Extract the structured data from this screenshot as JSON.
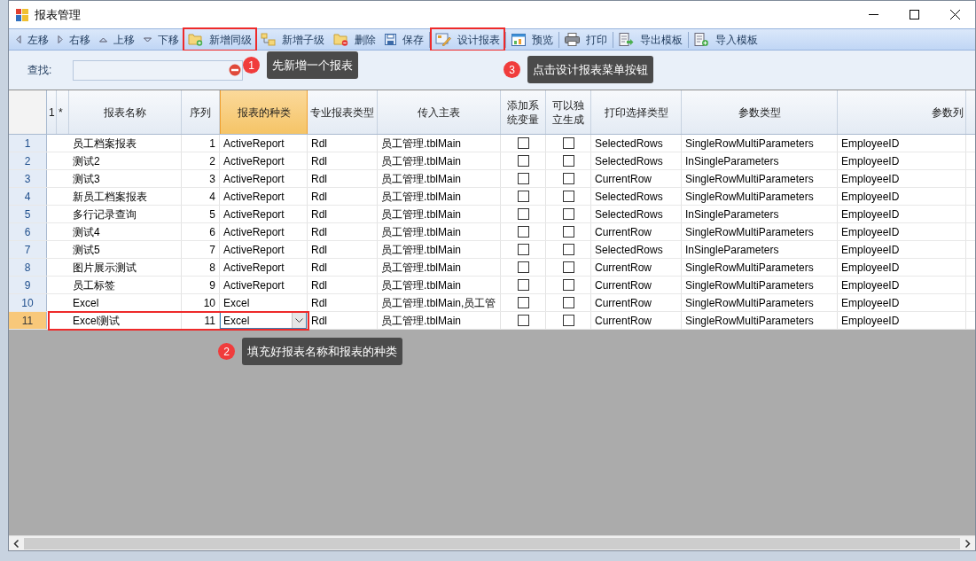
{
  "window": {
    "title": "报表管理"
  },
  "toolbar": [
    {
      "kind": "left",
      "label": "左移",
      "highlighted": false
    },
    {
      "kind": "right",
      "label": "右移",
      "highlighted": false
    },
    {
      "kind": "up",
      "label": "上移",
      "highlighted": false
    },
    {
      "kind": "down",
      "label": "下移",
      "highlighted": false
    },
    {
      "kind": "folder-add",
      "label": "新增同级",
      "highlighted": true
    },
    {
      "kind": "tree",
      "label": "新增子级",
      "highlighted": false
    },
    {
      "kind": "folder-remove",
      "label": "删除",
      "highlighted": false
    },
    {
      "kind": "save",
      "label": "保存",
      "highlighted": false
    },
    {
      "kind": "design",
      "label": "设计报表",
      "highlighted": true
    },
    {
      "kind": "preview",
      "label": "预览",
      "highlighted": false
    },
    {
      "kind": "print",
      "label": "打印",
      "highlighted": false
    },
    {
      "kind": "export",
      "label": "导出模板",
      "highlighted": false
    },
    {
      "kind": "import",
      "label": "导入模板",
      "highlighted": false
    }
  ],
  "search": {
    "label": "查找:"
  },
  "table": {
    "columns": [
      {
        "label": "1",
        "selected": false
      },
      {
        "label": "*",
        "selected": false
      },
      {
        "label": "报表名称",
        "selected": false
      },
      {
        "label": "序列",
        "selected": false
      },
      {
        "label": "报表的种类",
        "selected": true
      },
      {
        "label": "专业报表类型",
        "selected": false
      },
      {
        "label": "传入主表",
        "selected": false
      },
      {
        "label": "添加系统变量",
        "selected": false
      },
      {
        "label": "可以独立生成",
        "selected": false
      },
      {
        "label": "打印选择类型",
        "selected": false
      },
      {
        "label": "参数类型",
        "selected": false
      },
      {
        "label": "参数列",
        "selected": false
      }
    ],
    "rows": [
      {
        "number": "1",
        "selected": false,
        "highlighted": false,
        "editing": false,
        "name": "员工档案报表",
        "seq": "1",
        "report_kind": "ActiveReport",
        "pro_type": "Rdl",
        "main_table": "员工管理.tblMain",
        "add_system_variable": false,
        "independent": false,
        "print_select": "SelectedRows",
        "param_type": "SingleRowMultiParameters",
        "param_column": "EmployeeID"
      },
      {
        "number": "2",
        "selected": false,
        "highlighted": false,
        "editing": false,
        "name": "测试2",
        "seq": "2",
        "report_kind": "ActiveReport",
        "pro_type": "Rdl",
        "main_table": "员工管理.tblMain",
        "add_system_variable": false,
        "independent": false,
        "print_select": "SelectedRows",
        "param_type": "InSingleParameters",
        "param_column": "EmployeeID"
      },
      {
        "number": "3",
        "selected": false,
        "highlighted": false,
        "editing": false,
        "name": "测试3",
        "seq": "3",
        "report_kind": "ActiveReport",
        "pro_type": "Rdl",
        "main_table": "员工管理.tblMain",
        "add_system_variable": false,
        "independent": false,
        "print_select": "CurrentRow",
        "param_type": "SingleRowMultiParameters",
        "param_column": "EmployeeID"
      },
      {
        "number": "4",
        "selected": false,
        "highlighted": false,
        "editing": false,
        "name": "新员工档案报表",
        "seq": "4",
        "report_kind": "ActiveReport",
        "pro_type": "Rdl",
        "main_table": "员工管理.tblMain",
        "add_system_variable": false,
        "independent": false,
        "print_select": "SelectedRows",
        "param_type": "SingleRowMultiParameters",
        "param_column": "EmployeeID"
      },
      {
        "number": "5",
        "selected": false,
        "highlighted": false,
        "editing": false,
        "name": "多行记录查询",
        "seq": "5",
        "report_kind": "ActiveReport",
        "pro_type": "Rdl",
        "main_table": "员工管理.tblMain",
        "add_system_variable": false,
        "independent": false,
        "print_select": "SelectedRows",
        "param_type": "InSingleParameters",
        "param_column": "EmployeeID"
      },
      {
        "number": "6",
        "selected": false,
        "highlighted": false,
        "editing": false,
        "name": "测试4",
        "seq": "6",
        "report_kind": "ActiveReport",
        "pro_type": "Rdl",
        "main_table": "员工管理.tblMain",
        "add_system_variable": false,
        "independent": false,
        "print_select": "CurrentRow",
        "param_type": "SingleRowMultiParameters",
        "param_column": "EmployeeID"
      },
      {
        "number": "7",
        "selected": false,
        "highlighted": false,
        "editing": false,
        "name": "测试5",
        "seq": "7",
        "report_kind": "ActiveReport",
        "pro_type": "Rdl",
        "main_table": "员工管理.tblMain",
        "add_system_variable": false,
        "independent": false,
        "print_select": "SelectedRows",
        "param_type": "InSingleParameters",
        "param_column": "EmployeeID"
      },
      {
        "number": "8",
        "selected": false,
        "highlighted": false,
        "editing": false,
        "name": "图片展示测试",
        "seq": "8",
        "report_kind": "ActiveReport",
        "pro_type": "Rdl",
        "main_table": "员工管理.tblMain",
        "add_system_variable": false,
        "independent": false,
        "print_select": "CurrentRow",
        "param_type": "SingleRowMultiParameters",
        "param_column": "EmployeeID"
      },
      {
        "number": "9",
        "selected": false,
        "highlighted": false,
        "editing": false,
        "name": "员工标签",
        "seq": "9",
        "report_kind": "ActiveReport",
        "pro_type": "Rdl",
        "main_table": "员工管理.tblMain",
        "add_system_variable": false,
        "independent": false,
        "print_select": "CurrentRow",
        "param_type": "SingleRowMultiParameters",
        "param_column": "EmployeeID"
      },
      {
        "number": "10",
        "selected": false,
        "highlighted": false,
        "editing": false,
        "name": "Excel",
        "seq": "10",
        "report_kind": "Excel",
        "pro_type": "Rdl",
        "main_table": "员工管理.tblMain,员工管",
        "add_system_variable": false,
        "independent": false,
        "print_select": "CurrentRow",
        "param_type": "SingleRowMultiParameters",
        "param_column": "EmployeeID"
      },
      {
        "number": "11",
        "selected": true,
        "highlighted": true,
        "editing": true,
        "name": "Excel测试",
        "seq": "11",
        "report_kind": "Excel",
        "pro_type": "Rdl",
        "main_table": "员工管理.tblMain",
        "add_system_variable": false,
        "independent": false,
        "print_select": "CurrentRow",
        "param_type": "SingleRowMultiParameters",
        "param_column": "EmployeeID"
      }
    ]
  },
  "annotations": [
    {
      "number": "1",
      "text": "先新增一个报表"
    },
    {
      "number": "2",
      "text": "填充好报表名称和报表的种类"
    },
    {
      "number": "3",
      "text": "点击设计报表菜单按钮"
    }
  ]
}
